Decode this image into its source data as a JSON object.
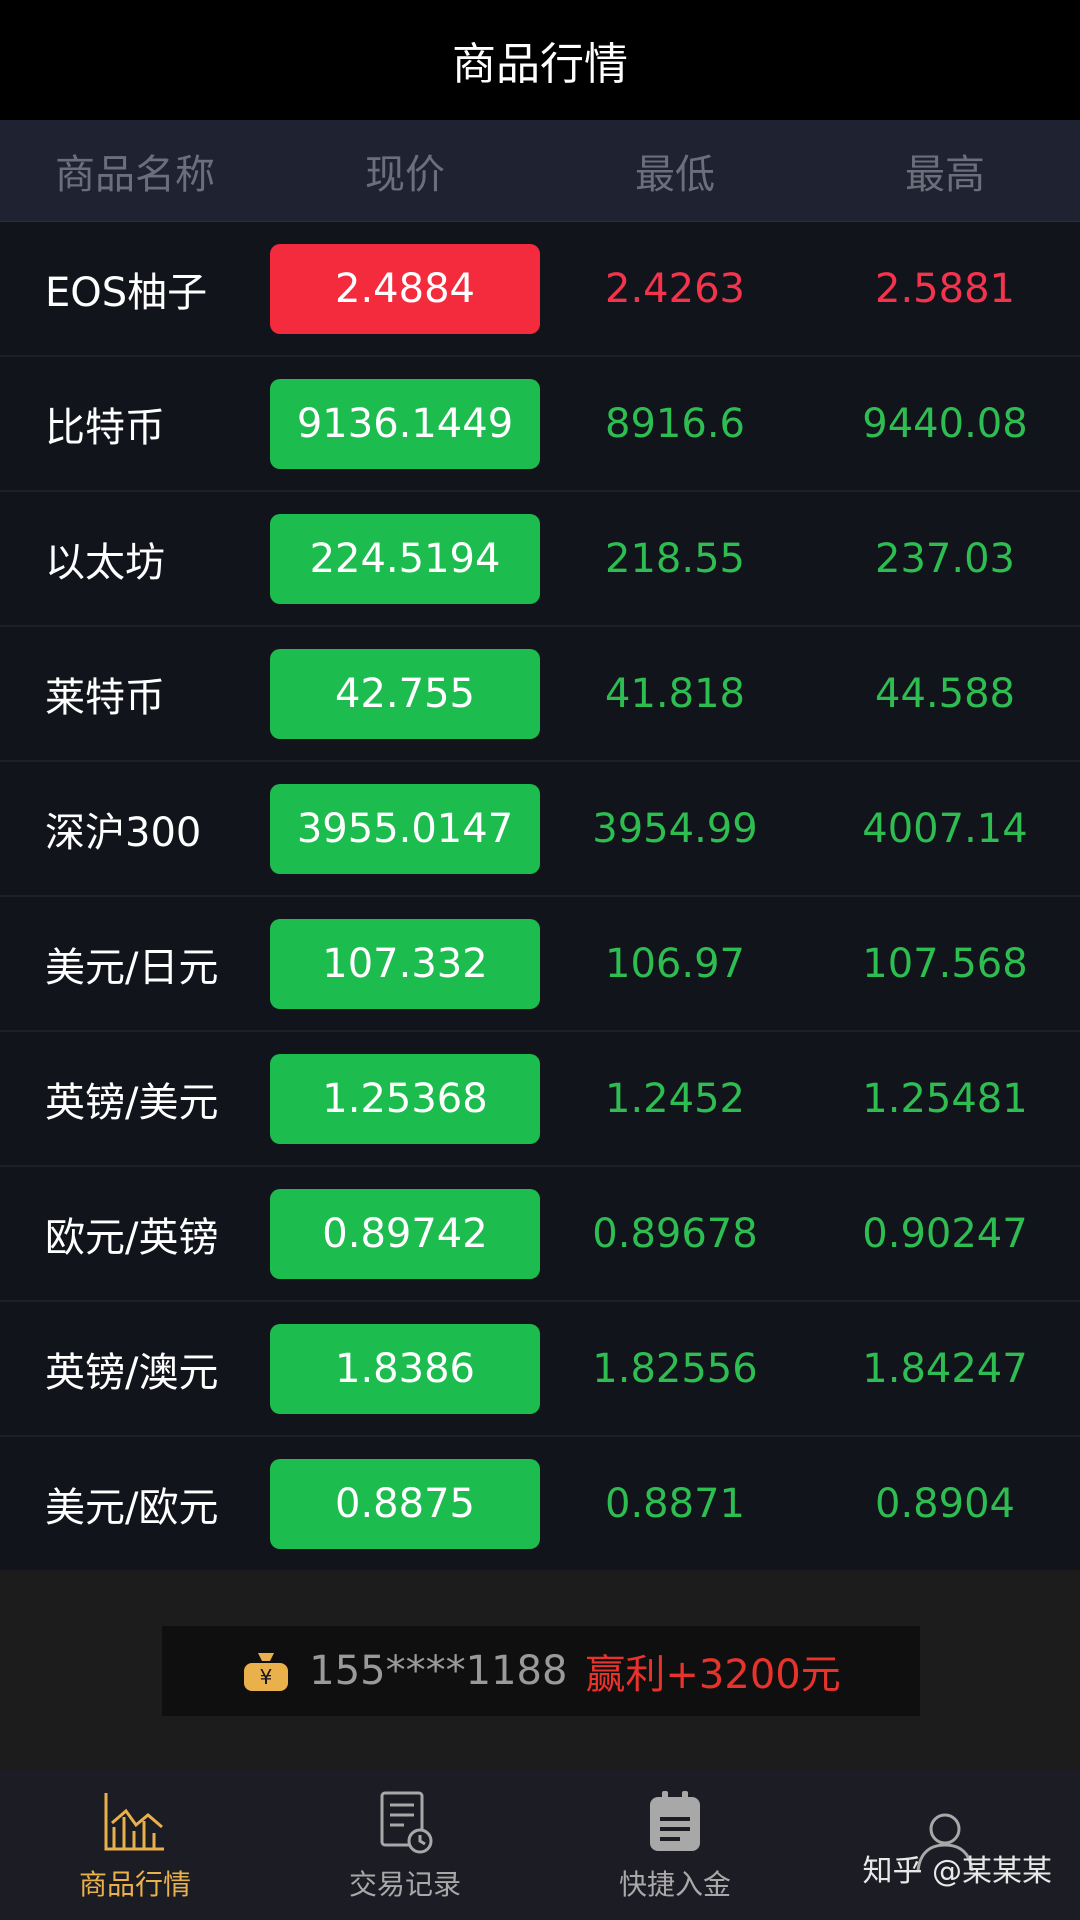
{
  "header": {
    "title": "商品行情"
  },
  "columns": [
    "商品名称",
    "现价",
    "最低",
    "最高"
  ],
  "rows": [
    {
      "name": "EOS柚子",
      "price": "2.4884",
      "low": "2.4263",
      "high": "2.5881",
      "trend": "down"
    },
    {
      "name": "比特币",
      "price": "9136.1449",
      "low": "8916.6",
      "high": "9440.08",
      "trend": "up"
    },
    {
      "name": "以太坊",
      "price": "224.5194",
      "low": "218.55",
      "high": "237.03",
      "trend": "up"
    },
    {
      "name": "莱特币",
      "price": "42.755",
      "low": "41.818",
      "high": "44.588",
      "trend": "up"
    },
    {
      "name": "深沪300",
      "price": "3955.0147",
      "low": "3954.99",
      "high": "4007.14",
      "trend": "up"
    },
    {
      "name": "美元/日元",
      "price": "107.332",
      "low": "106.97",
      "high": "107.568",
      "trend": "up"
    },
    {
      "name": "英镑/美元",
      "price": "1.25368",
      "low": "1.2452",
      "high": "1.25481",
      "trend": "up"
    },
    {
      "name": "欧元/英镑",
      "price": "0.89742",
      "low": "0.89678",
      "high": "0.90247",
      "trend": "up"
    },
    {
      "name": "英镑/澳元",
      "price": "1.8386",
      "low": "1.82556",
      "high": "1.84247",
      "trend": "up"
    },
    {
      "name": "美元/欧元",
      "price": "0.8875",
      "low": "0.8871",
      "high": "0.8904",
      "trend": "up"
    }
  ],
  "ticker": {
    "phone": "155****1188",
    "win": "赢利+3200元",
    "icon": "coin-bag-icon"
  },
  "tabs": [
    {
      "label": "商品行情",
      "icon": "chart-icon",
      "active": true
    },
    {
      "label": "交易记录",
      "icon": "record-icon",
      "active": false
    },
    {
      "label": "快捷入金",
      "icon": "clipboard-icon",
      "active": false
    },
    {
      "label": "",
      "icon": "user-icon",
      "active": false
    }
  ],
  "watermark": "知乎 @某某某",
  "colors": {
    "up": "#1cbd4e",
    "down": "#f42a3d",
    "active_tab": "#e9b04b"
  }
}
